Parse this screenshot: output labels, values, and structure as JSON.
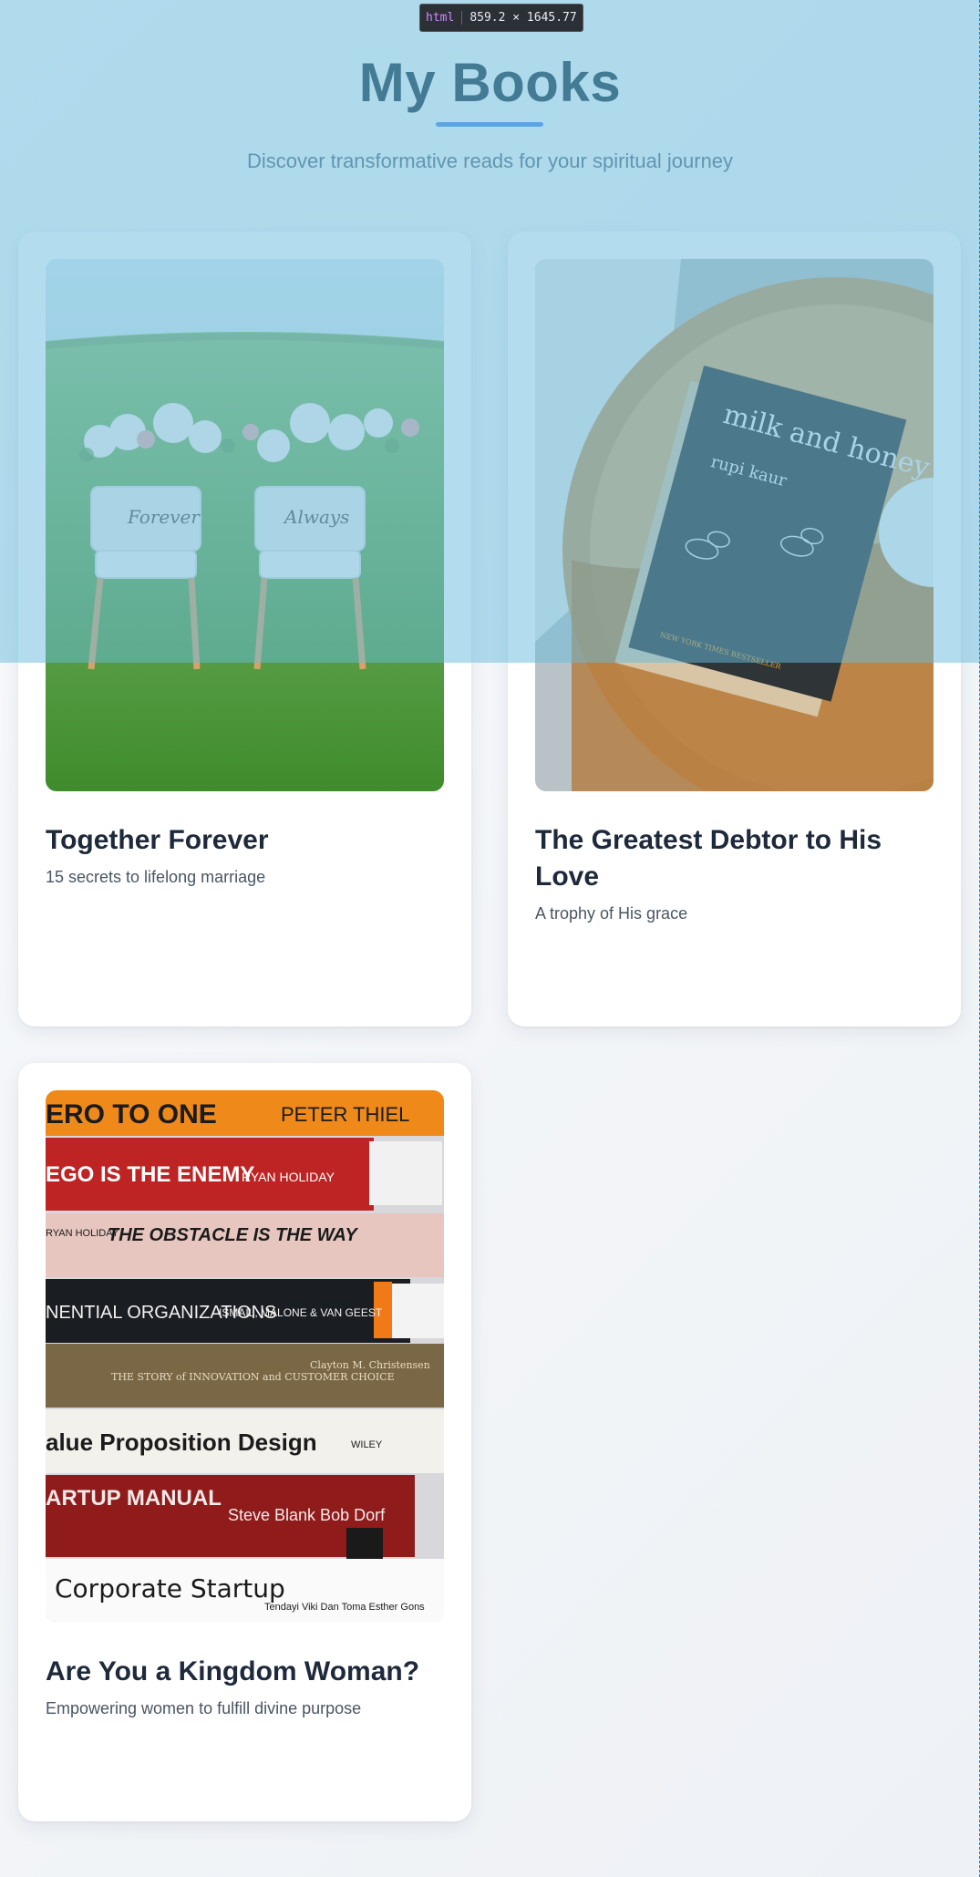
{
  "devtools": {
    "tag": "html",
    "size": "859.2 × 1645.77"
  },
  "header": {
    "title": "My Books",
    "subtitle": "Discover transformative reads for your spiritual journey"
  },
  "books": [
    {
      "title": "Together Forever",
      "subtitle": "15 secrets to lifelong marriage",
      "cover": {
        "chair_left": "Forever",
        "chair_right": "Always"
      }
    },
    {
      "title": "The Greatest Debtor to His Love",
      "subtitle": "A trophy of His grace",
      "cover": {
        "book_title": "milk and honey",
        "author": "rupi kaur",
        "banner": "NEW YORK TIMES BESTSELLER"
      }
    },
    {
      "title": "Are You a Kingdom Woman?",
      "subtitle": "Empowering women to fulfill divine purpose",
      "cover": {
        "spines": [
          {
            "title": "ERO TO ONE",
            "author": "PETER THIEL"
          },
          {
            "title": "EGO IS THE ENEMY",
            "author": "RYAN HOLIDAY"
          },
          {
            "title": "THE OBSTACLE IS THE WAY",
            "author": "RYAN HOLIDAY"
          },
          {
            "title": "NENTIAL ORGANIZATIONS",
            "author": "ISMAIL, MALONE & VAN GEEST"
          },
          {
            "title": "THE STORY of INNOVATION and CUSTOMER CHOICE",
            "author": "Clayton M. Christensen"
          },
          {
            "title": "alue Proposition Design",
            "author": "WILEY"
          },
          {
            "title": "ARTUP MANUAL",
            "author": "Steve Blank Bob Dorf"
          },
          {
            "title": "Corporate Startup",
            "author": "Tendayi Viki Dan Toma Esther Gons"
          }
        ]
      }
    }
  ],
  "colors": {
    "accent": "#4f8fe6",
    "title": "#1f3a4d",
    "card_title": "#1e293b",
    "overlay": "#68bcde"
  }
}
